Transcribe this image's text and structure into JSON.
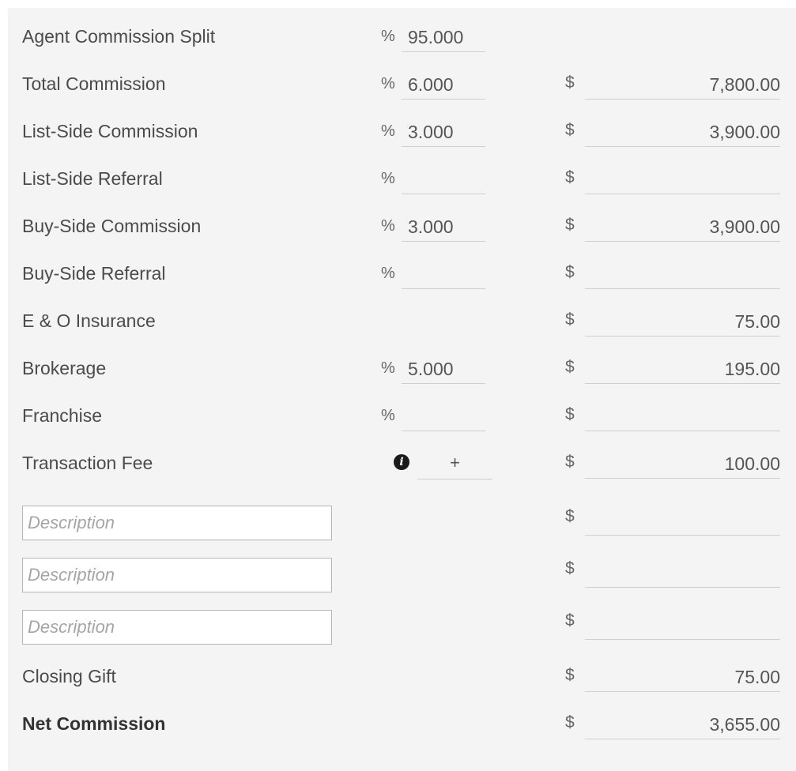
{
  "rows": [
    {
      "label": "Agent Commission Split",
      "pct_symbol": "%",
      "pct": "95.000"
    },
    {
      "label": "Total Commission",
      "pct_symbol": "%",
      "pct": "6.000",
      "dollar": "$",
      "amount": "7,800.00"
    },
    {
      "label": "List-Side Commission",
      "pct_symbol": "%",
      "pct": "3.000",
      "dollar": "$",
      "amount": "3,900.00"
    },
    {
      "label": "List-Side Referral",
      "pct_symbol": "%",
      "pct": "",
      "dollar": "$",
      "amount": ""
    },
    {
      "label": "Buy-Side Commission",
      "pct_symbol": "%",
      "pct": "3.000",
      "dollar": "$",
      "amount": "3,900.00"
    },
    {
      "label": "Buy-Side Referral",
      "pct_symbol": "%",
      "pct": "",
      "dollar": "$",
      "amount": ""
    },
    {
      "label": "E & O Insurance",
      "dollar": "$",
      "amount": "75.00"
    },
    {
      "label": "Brokerage",
      "pct_symbol": "%",
      "pct": "5.000",
      "dollar": "$",
      "amount": "195.00"
    },
    {
      "label": "Franchise",
      "pct_symbol": "%",
      "pct": "",
      "dollar": "$",
      "amount": ""
    },
    {
      "label": "Transaction Fee",
      "info_icon": "info-icon",
      "plus": "+",
      "dollar": "$",
      "amount": "100.00"
    },
    {
      "desc_placeholder": "Description",
      "dollar": "$",
      "amount": ""
    },
    {
      "desc_placeholder": "Description",
      "dollar": "$",
      "amount": ""
    },
    {
      "desc_placeholder": "Description",
      "dollar": "$",
      "amount": ""
    },
    {
      "label": "Closing Gift",
      "dollar": "$",
      "amount": "75.00"
    },
    {
      "label": "Net Commission",
      "dollar": "$",
      "amount": "3,655.00"
    }
  ]
}
